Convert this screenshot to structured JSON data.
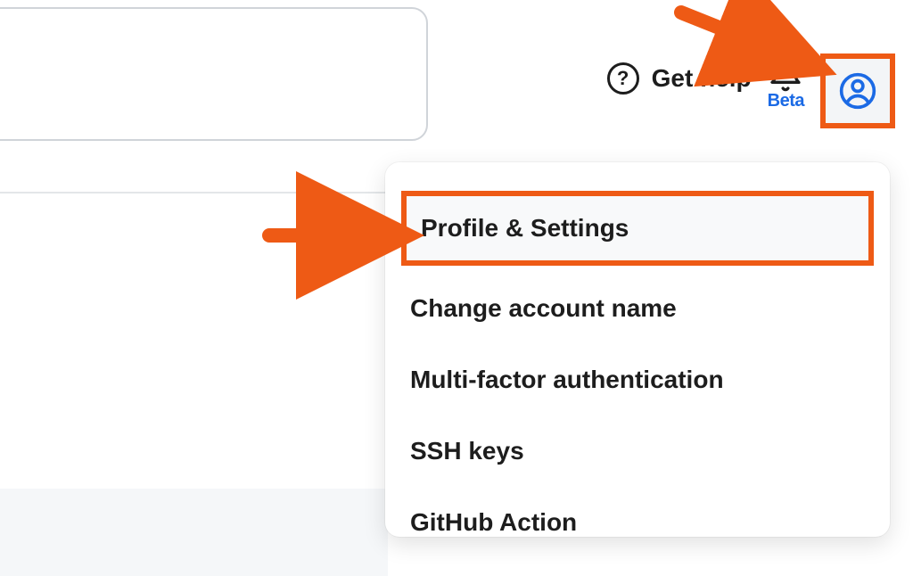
{
  "header": {
    "help_label": "Get help",
    "notifications_badge": "Beta"
  },
  "dropdown": {
    "items": [
      "Profile & Settings",
      "Change account name",
      "Multi-factor authentication",
      "SSH keys",
      "GitHub Action"
    ]
  },
  "annotations": {
    "highlight_color": "#ee5a15",
    "arrows": [
      "avatar-button",
      "profile-settings-item"
    ]
  }
}
